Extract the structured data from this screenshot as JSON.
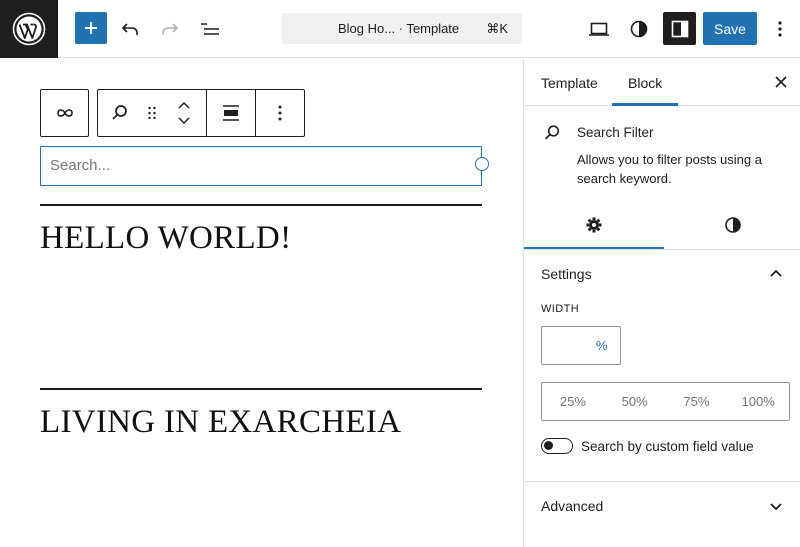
{
  "header": {
    "document_title": "Blog Ho... · Template",
    "shortcut": "⌘K",
    "save_label": "Save"
  },
  "canvas": {
    "search_placeholder": "Search...",
    "posts": [
      {
        "title": "HELLO WORLD!"
      },
      {
        "title": "LIVING IN EXARCHEIA"
      }
    ]
  },
  "sidebar": {
    "tabs": [
      {
        "label": "Template",
        "active": false
      },
      {
        "label": "Block",
        "active": true
      }
    ],
    "block": {
      "name": "Search Filter",
      "description": "Allows you to filter posts using a search keyword."
    },
    "settings": {
      "title": "Settings",
      "width_label": "WIDTH",
      "width_value": "",
      "width_unit": "%",
      "width_presets": [
        "25%",
        "50%",
        "75%",
        "100%"
      ],
      "toggle_label": "Search by custom field value",
      "toggle_on": false
    },
    "advanced": {
      "title": "Advanced"
    }
  },
  "colors": {
    "accent": "#2271b1",
    "dark": "#1e1e1e",
    "border": "#e0e0e0"
  }
}
